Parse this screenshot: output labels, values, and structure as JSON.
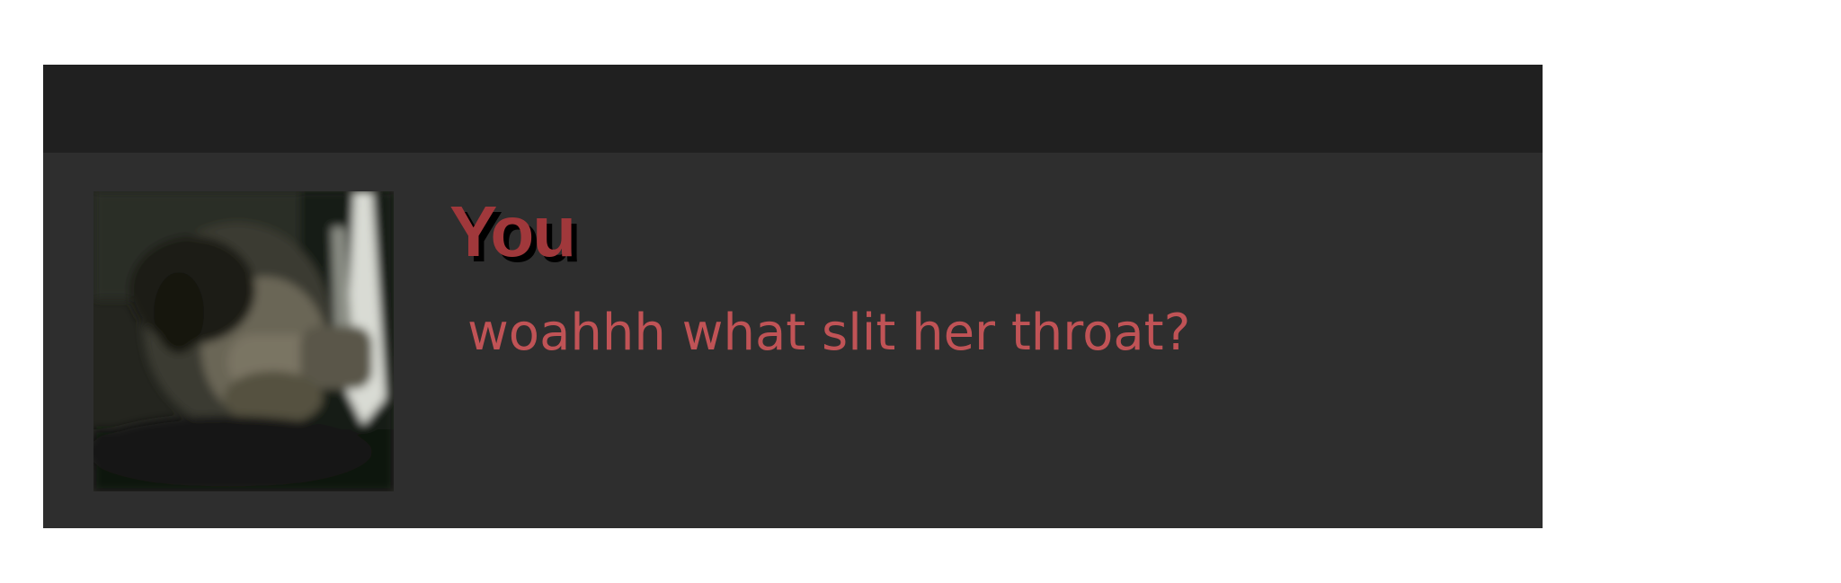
{
  "post": {
    "author": "You",
    "message": "woahhh what slit her throat?",
    "avatar_icon": "user-avatar-photo"
  },
  "colors": {
    "background": "#ffffff",
    "card": "#2e2e2e",
    "header": "#202020",
    "author_text": "#a0383b",
    "message_text": "#c05356"
  }
}
